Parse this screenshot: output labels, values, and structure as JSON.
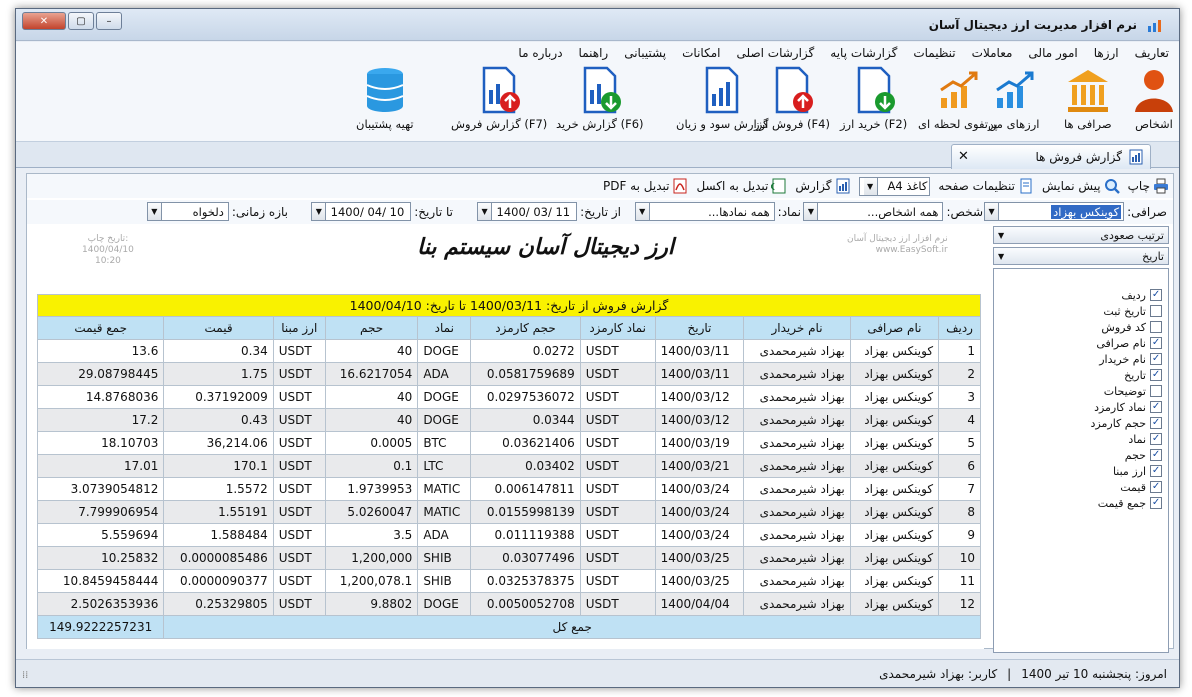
{
  "window": {
    "title": "نرم افزار مدیریت ارز دیجیتال آسان"
  },
  "menu": [
    "تعاریف",
    "ارزها",
    "امور مالی",
    "معاملات",
    "تنظیمات",
    "گزارشات پایه",
    "گزارشات اصلی",
    "امکانات",
    "پشتیبانی",
    "راهنما",
    "درباره ما"
  ],
  "ribbon": [
    {
      "label": "اشخاص",
      "icon": "person-icon"
    },
    {
      "label": "صرافی ها",
      "icon": "bank-icon"
    },
    {
      "label": "ارزهای من",
      "icon": "chart-up-icon"
    },
    {
      "label": "پرتفوی لحظه ای",
      "icon": "chart-up-orange-icon"
    },
    {
      "label": "خرید ارز (F2)",
      "icon": "doc-down-icon"
    },
    {
      "label": "فروش ارز (F4)",
      "icon": "doc-up-icon"
    },
    {
      "label": "گزارش سود و زیان",
      "icon": "report-chart-icon"
    },
    {
      "label": "گزارش خرید (F6)",
      "icon": "report-down-icon"
    },
    {
      "label": "گزارش فروش (F7)",
      "icon": "report-up-icon"
    },
    {
      "label": "تهیه پشتیبان",
      "icon": "database-icon"
    }
  ],
  "tab": {
    "label": "گزارش فروش ها"
  },
  "toolbar": {
    "print": "چاپ",
    "preview": "پیش نمایش",
    "page_settings": "تنظیمات صفحه",
    "paper": "کاغذ A4",
    "report": "گزارش",
    "excel": "تبدیل به اکسل",
    "pdf": "تبدیل به PDF"
  },
  "filters": {
    "exchange_label": "صرافی:",
    "exchange_value": "کوینکس بهزاد",
    "person_label": "شخص:",
    "person_value": "همه اشخاص...",
    "symbol_label": "نماد:",
    "symbol_value": "همه نمادها...",
    "from_label": "از تاریخ:",
    "from_value": "1400/ 03/ 11",
    "to_label": "تا تاریخ:",
    "to_value": "1400/ 04/ 10",
    "period_label": "بازه زمانی:",
    "period_value": "دلخواه"
  },
  "report": {
    "logo_text": "ارز دیجیتال آسان سیستم بنا",
    "app_name_small": "نرم افزار ارز دیجیتال آسان",
    "site": "www.EasySoft.ir",
    "print_date_label": "تاریخ چاپ:",
    "print_date": "1400/04/10",
    "print_time": "10:20",
    "caption": "گزارش فروش از تاریخ: 1400/03/11 تا تاریخ: 1400/04/10",
    "columns": [
      "ردیف",
      "نام صرافی",
      "نام خریدار",
      "تاریخ",
      "نماد کارمزد",
      "حجم کارمزد",
      "نماد",
      "حجم",
      "ارز مبنا",
      "قیمت",
      "جمع قیمت"
    ],
    "rows": [
      [
        "1",
        "کوینکس بهزاد",
        "بهزاد شیرمحمدی",
        "1400/03/11",
        "USDT",
        "0.0272",
        "DOGE",
        "40",
        "USDT",
        "0.34",
        "13.6"
      ],
      [
        "2",
        "کوینکس بهزاد",
        "بهزاد شیرمحمدی",
        "1400/03/11",
        "USDT",
        "0.0581759689",
        "ADA",
        "16.6217054",
        "USDT",
        "1.75",
        "29.08798445"
      ],
      [
        "3",
        "کوینکس بهزاد",
        "بهزاد شیرمحمدی",
        "1400/03/12",
        "USDT",
        "0.0297536072",
        "DOGE",
        "40",
        "USDT",
        "0.37192009",
        "14.8768036"
      ],
      [
        "4",
        "کوینکس بهزاد",
        "بهزاد شیرمحمدی",
        "1400/03/12",
        "USDT",
        "0.0344",
        "DOGE",
        "40",
        "USDT",
        "0.43",
        "17.2"
      ],
      [
        "5",
        "کوینکس بهزاد",
        "بهزاد شیرمحمدی",
        "1400/03/19",
        "USDT",
        "0.03621406",
        "BTC",
        "0.0005",
        "USDT",
        "36,214.06",
        "18.10703"
      ],
      [
        "6",
        "کوینکس بهزاد",
        "بهزاد شیرمحمدی",
        "1400/03/21",
        "USDT",
        "0.03402",
        "LTC",
        "0.1",
        "USDT",
        "170.1",
        "17.01"
      ],
      [
        "7",
        "کوینکس بهزاد",
        "بهزاد شیرمحمدی",
        "1400/03/24",
        "USDT",
        "0.006147811",
        "MATIC",
        "1.9739953",
        "USDT",
        "1.5572",
        "3.0739054812"
      ],
      [
        "8",
        "کوینکس بهزاد",
        "بهزاد شیرمحمدی",
        "1400/03/24",
        "USDT",
        "0.0155998139",
        "MATIC",
        "5.0260047",
        "USDT",
        "1.55191",
        "7.799906954"
      ],
      [
        "9",
        "کوینکس بهزاد",
        "بهزاد شیرمحمدی",
        "1400/03/24",
        "USDT",
        "0.011119388",
        "ADA",
        "3.5",
        "USDT",
        "1.588484",
        "5.559694"
      ],
      [
        "10",
        "کوینکس بهزاد",
        "بهزاد شیرمحمدی",
        "1400/03/25",
        "USDT",
        "0.03077496",
        "SHIB",
        "1,200,000",
        "USDT",
        "0.0000085486",
        "10.25832"
      ],
      [
        "11",
        "کوینکس بهزاد",
        "بهزاد شیرمحمدی",
        "1400/03/25",
        "USDT",
        "0.0325378375",
        "SHIB",
        "1,200,078.1",
        "USDT",
        "0.0000090377",
        "10.8459458444"
      ],
      [
        "12",
        "کوینکس بهزاد",
        "بهزاد شیرمحمدی",
        "1400/04/04",
        "USDT",
        "0.0050052708",
        "DOGE",
        "9.8802",
        "USDT",
        "0.25329805",
        "2.5026353936"
      ]
    ],
    "total_label": "جمع کل",
    "total_value": "149.9222257231"
  },
  "side_panel": {
    "sort_label": "ترتیب صعودی",
    "sort_field": "تاریخ",
    "fields": [
      {
        "label": "ردیف",
        "checked": true
      },
      {
        "label": "تاریخ ثبت",
        "checked": false
      },
      {
        "label": "کد فروش",
        "checked": false
      },
      {
        "label": "نام صرافی",
        "checked": true
      },
      {
        "label": "نام خریدار",
        "checked": true
      },
      {
        "label": "تاریخ",
        "checked": true
      },
      {
        "label": "توضیحات",
        "checked": false
      },
      {
        "label": "نماد کارمزد",
        "checked": true
      },
      {
        "label": "حجم کارمزد",
        "checked": true
      },
      {
        "label": "نماد",
        "checked": true
      },
      {
        "label": "حجم",
        "checked": true
      },
      {
        "label": "ارز مبنا",
        "checked": true
      },
      {
        "label": "قیمت",
        "checked": true
      },
      {
        "label": "جمع قیمت",
        "checked": true
      }
    ]
  },
  "status": {
    "date": "امروز: پنجشنبه 10 تیر 1400",
    "sep": "|",
    "user": "کاربر: بهزاد شیرمحمدی"
  }
}
